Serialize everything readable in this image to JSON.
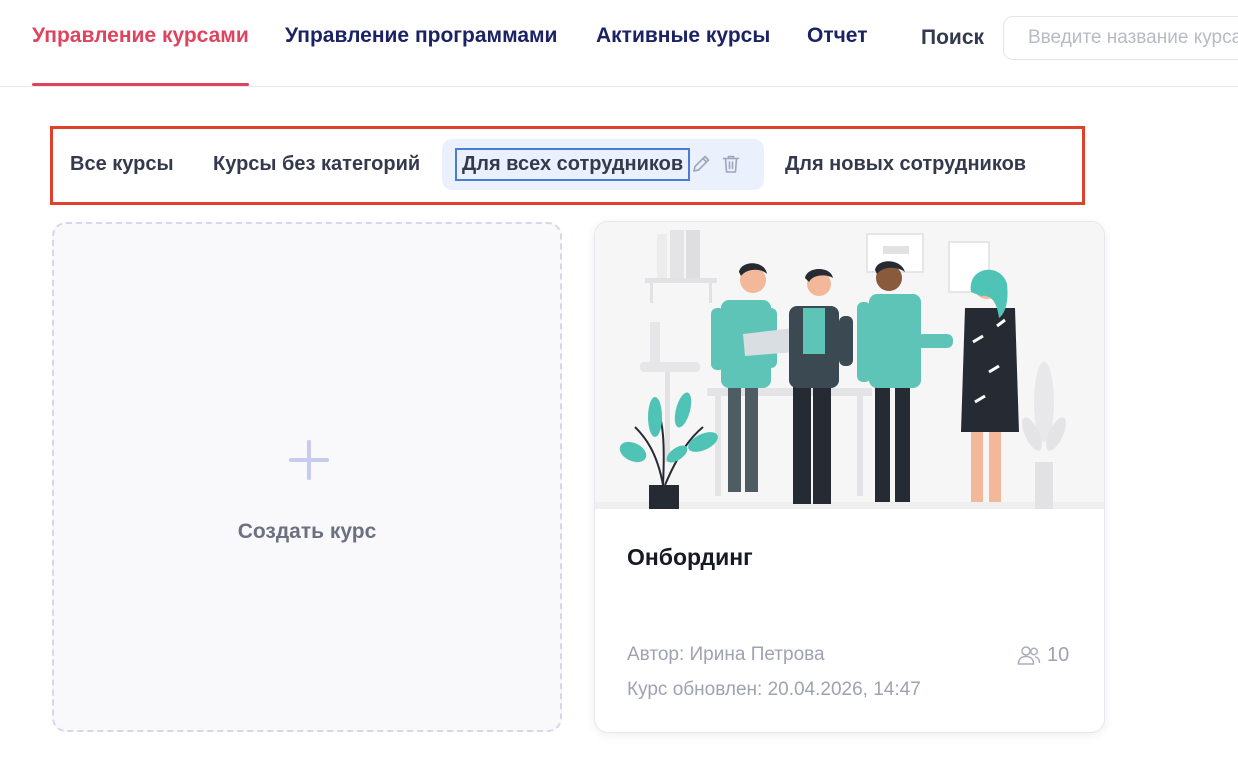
{
  "nav": {
    "tabs": [
      {
        "label": "Управление курсами",
        "active": true
      },
      {
        "label": "Управление программами",
        "active": false
      },
      {
        "label": "Активные курсы",
        "active": false
      },
      {
        "label": "Отчет",
        "active": false
      }
    ],
    "search_label": "Поиск",
    "search_placeholder": "Введите название курса"
  },
  "categories": {
    "items": [
      {
        "label": "Все курсы"
      },
      {
        "label": "Курсы без категорий"
      },
      {
        "label": "Для всех сотрудников",
        "selected": true
      },
      {
        "label": "Для новых сотрудников"
      }
    ],
    "icons": [
      "pencil-icon",
      "trash-icon"
    ]
  },
  "create_card": {
    "label": "Создать курс",
    "icon": "plus-icon"
  },
  "course": {
    "title": "Онбординг",
    "author": "Автор: Ирина Петрова",
    "updated": "Курс обновлен: 20.04.2026, 14:47",
    "participants_count": "10",
    "participants_icon": "users-icon"
  },
  "colors": {
    "accent": "#e0435e",
    "nav_text": "#1c2266",
    "highlight_border": "#e0412b",
    "selected_bg": "#ebf1fc",
    "selected_outline": "#4a7bd6",
    "illustration_teal": "#4fc3b6"
  }
}
